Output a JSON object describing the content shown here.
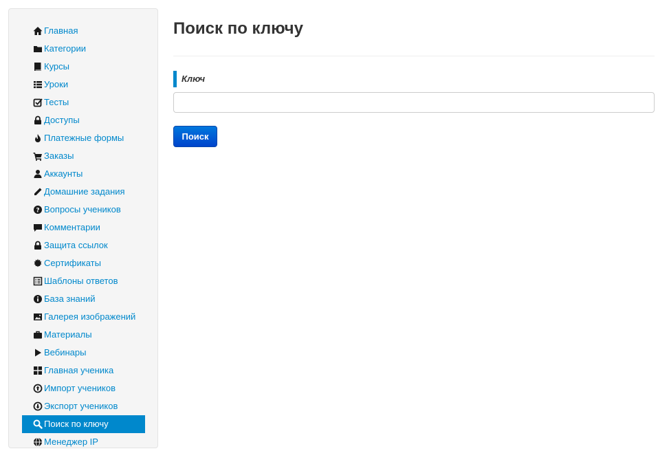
{
  "sidebar": {
    "items": [
      {
        "label": "Главная",
        "icon": "home-icon"
      },
      {
        "label": "Категории",
        "icon": "folder-icon"
      },
      {
        "label": "Курсы",
        "icon": "book-icon"
      },
      {
        "label": "Уроки",
        "icon": "list-icon"
      },
      {
        "label": "Тесты",
        "icon": "check-square-icon"
      },
      {
        "label": "Доступы",
        "icon": "lock-icon"
      },
      {
        "label": "Платежные формы",
        "icon": "fire-icon"
      },
      {
        "label": "Заказы",
        "icon": "cart-icon"
      },
      {
        "label": "Аккаунты",
        "icon": "user-icon"
      },
      {
        "label": "Домашние задания",
        "icon": "pencil-icon"
      },
      {
        "label": "Вопросы учеников",
        "icon": "question-circle-icon"
      },
      {
        "label": "Комментарии",
        "icon": "comment-icon"
      },
      {
        "label": "Защита ссылок",
        "icon": "lock-icon"
      },
      {
        "label": "Сертификаты",
        "icon": "certificate-icon"
      },
      {
        "label": "Шаблоны ответов",
        "icon": "list-alt-icon"
      },
      {
        "label": "База знаний",
        "icon": "info-circle-icon"
      },
      {
        "label": "Галерея изображений",
        "icon": "picture-icon"
      },
      {
        "label": "Материалы",
        "icon": "briefcase-icon"
      },
      {
        "label": "Вебинары",
        "icon": "play-icon"
      },
      {
        "label": "Главная ученика",
        "icon": "th-large-icon"
      },
      {
        "label": "Импорт учеников",
        "icon": "upload-circle-icon"
      },
      {
        "label": "Экспорт учеников",
        "icon": "download-circle-icon"
      },
      {
        "label": "Поиск по ключу",
        "icon": "search-icon",
        "active": true
      },
      {
        "label": "Менеджер IP",
        "icon": "globe-icon"
      }
    ]
  },
  "main": {
    "title": "Поиск по ключу",
    "field_label": "Ключ",
    "input_value": "",
    "input_placeholder": "",
    "search_button": "Поиск"
  },
  "colors": {
    "accent": "#0088cc",
    "sidebar_bg": "#f5f5f5",
    "button_top": "#0077dd",
    "button_bottom": "#0044cc"
  }
}
